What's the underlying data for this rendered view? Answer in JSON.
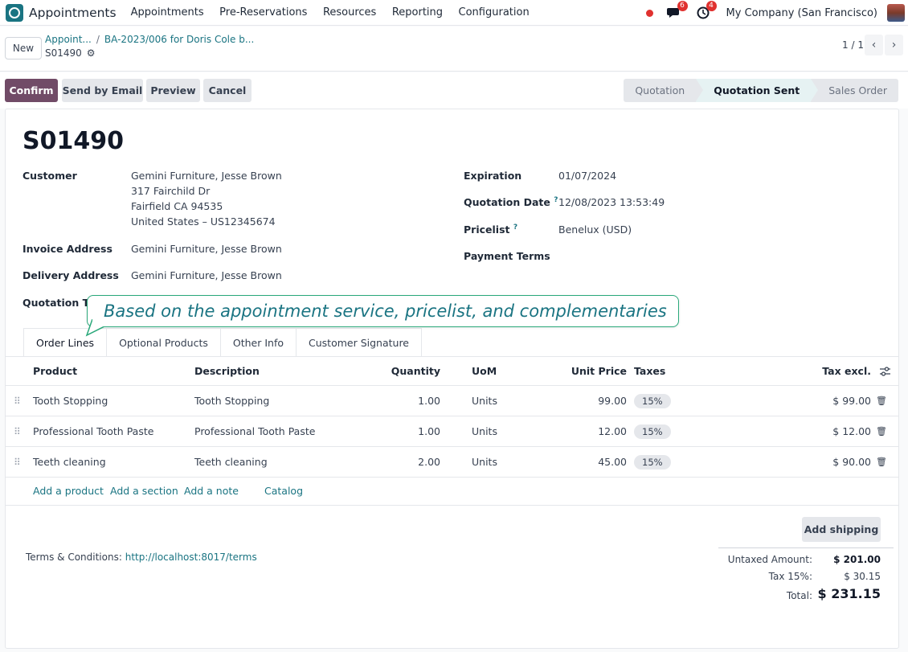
{
  "navbar": {
    "app_name": "Appointments",
    "menu": [
      "Appointments",
      "Pre-Reservations",
      "Resources",
      "Reporting",
      "Configuration"
    ],
    "messages_count": "6",
    "activities_count": "4",
    "company": "My Company (San Francisco)"
  },
  "control": {
    "new_label": "New",
    "breadcrumb": [
      "Appoint...",
      "BA-2023/006 for Doris Cole b..."
    ],
    "breadcrumb_sep": "/",
    "record": "S01490",
    "pager": "1 / 1"
  },
  "actions": {
    "confirm": "Confirm",
    "send_email": "Send by Email",
    "preview": "Preview",
    "cancel": "Cancel"
  },
  "status_stages": [
    "Quotation",
    "Quotation Sent",
    "Sales Order"
  ],
  "status_active": "Quotation Sent",
  "form": {
    "title": "S01490",
    "customer_label": "Customer",
    "customer_lines": [
      "Gemini Furniture, Jesse Brown",
      "317 Fairchild Dr",
      "Fairfield CA 94535",
      "United States – US12345674"
    ],
    "invoice_label": "Invoice Address",
    "invoice_value": "Gemini Furniture, Jesse Brown",
    "delivery_label": "Delivery Address",
    "delivery_value": "Gemini Furniture, Jesse Brown",
    "quotation_template_label": "Quotation Ter",
    "expiration_label": "Expiration",
    "expiration_value": "01/07/2024",
    "quotation_date_label": "Quotation Date",
    "quotation_date_value": "12/08/2023 13:53:49",
    "pricelist_label": "Pricelist",
    "pricelist_value": "Benelux (USD)",
    "payment_terms_label": "Payment Terms",
    "help_mark": "?"
  },
  "tooltip": "Based on the appointment service, pricelist, and complementaries",
  "tabs": [
    "Order Lines",
    "Optional Products",
    "Other Info",
    "Customer Signature"
  ],
  "table": {
    "headers": {
      "product": "Product",
      "description": "Description",
      "quantity": "Quantity",
      "uom": "UoM",
      "unit_price": "Unit Price",
      "taxes": "Taxes",
      "tax_excl": "Tax excl."
    },
    "rows": [
      {
        "product": "Tooth Stopping",
        "description": "Tooth Stopping",
        "quantity": "1.00",
        "uom": "Units",
        "unit_price": "99.00",
        "tax": "15%",
        "subtotal": "$ 99.00"
      },
      {
        "product": "Professional Tooth Paste",
        "description": "Professional Tooth Paste",
        "quantity": "1.00",
        "uom": "Units",
        "unit_price": "12.00",
        "tax": "15%",
        "subtotal": "$ 12.00"
      },
      {
        "product": "Teeth cleaning",
        "description": "Teeth cleaning",
        "quantity": "2.00",
        "uom": "Units",
        "unit_price": "45.00",
        "tax": "15%",
        "subtotal": "$ 90.00"
      }
    ],
    "add_links": {
      "product": "Add a product",
      "section": "Add a section",
      "note": "Add a note",
      "catalog": "Catalog"
    }
  },
  "footer": {
    "add_shipping": "Add shipping",
    "terms_label": "Terms & Conditions:",
    "terms_link": "http://localhost:8017/terms",
    "untaxed_label": "Untaxed Amount:",
    "untaxed_value": "$ 201.00",
    "tax_label": "Tax 15%:",
    "tax_value": "$ 30.15",
    "total_label": "Total:",
    "total_value": "$ 231.15"
  },
  "colors": {
    "primary": "#714b67",
    "link": "#1a7482",
    "bubble_border": "#2aa87a",
    "badge": "#e0312f"
  }
}
